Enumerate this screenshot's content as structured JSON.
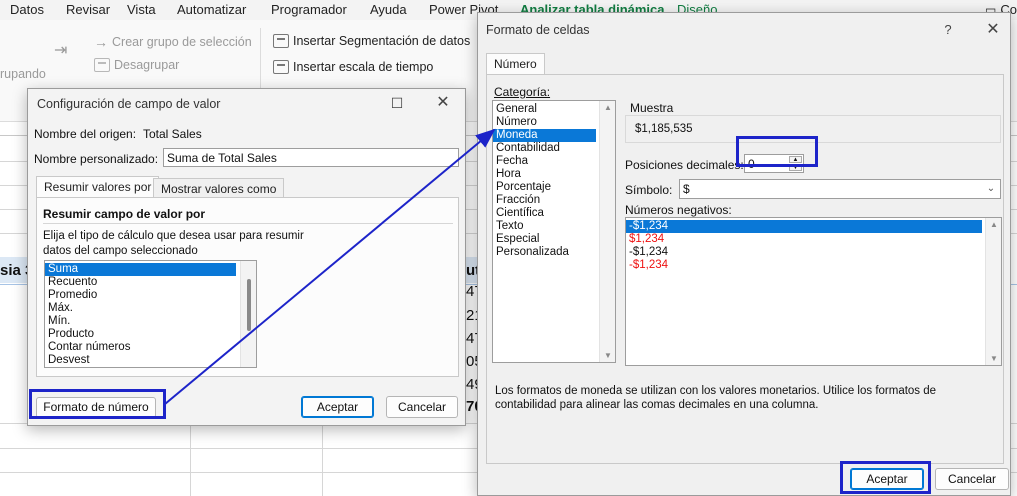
{
  "ribbon": {
    "tabs": [
      "Datos",
      "Revisar",
      "Vista",
      "Automatizar",
      "Programador",
      "Ayuda",
      "Power Pivot",
      "Analizar tabla dinámica",
      "Diseño"
    ],
    "commands": {
      "crear_grupo": "Crear grupo de selección",
      "desagrupar": "Desagrupar",
      "agrupando": "rupando",
      "insertar_segmentacion": "Insertar Segmentación de datos",
      "insertar_escala": "Insertar escala de tiempo",
      "co_partial": "Co"
    }
  },
  "sheet": {
    "cell_left": "sia 3",
    "col_partial": [
      "ut",
      "47",
      "21",
      "47",
      "05",
      "49",
      "70"
    ]
  },
  "value_field_dialog": {
    "title": "Configuración de campo de valor",
    "source_label": "Nombre del origen:",
    "source_value": "Total Sales",
    "custom_name_label": "Nombre personalizado:",
    "custom_name_value": "Suma de Total Sales",
    "tabs": [
      "Resumir valores por",
      "Mostrar valores como"
    ],
    "section_title": "Resumir campo de valor por",
    "description": "Elija el tipo de cálculo que desea usar para resumir datos del campo seleccionado",
    "description_line1": "Elija el tipo de cálculo que desea usar para resumir",
    "description_line2": "datos del campo seleccionado",
    "functions": [
      "Suma",
      "Recuento",
      "Promedio",
      "Máx.",
      "Mín.",
      "Producto",
      "Contar números",
      "Desvest"
    ],
    "selected_function": "Suma",
    "number_format_button": "Formato de número",
    "ok_button": "Aceptar",
    "cancel_button": "Cancelar"
  },
  "format_cells_dialog": {
    "title": "Formato de celdas",
    "help": "?",
    "tab": "Número",
    "category_label": "Categoría:",
    "categories": [
      "General",
      "Número",
      "Moneda",
      "Contabilidad",
      "Fecha",
      "Hora",
      "Porcentaje",
      "Fracción",
      "Científica",
      "Texto",
      "Especial",
      "Personalizada"
    ],
    "selected_category": "Moneda",
    "sample_label": "Muestra",
    "sample_value": "$1,185,535",
    "decimal_label": "Posiciones decimales:",
    "decimal_value": "0",
    "symbol_label": "Símbolo:",
    "symbol_value": "$",
    "negative_label": "Números negativos:",
    "negative_options": [
      {
        "text": "-$1,234",
        "color": "#ffffff",
        "selected": true
      },
      {
        "text": "$1,234",
        "color": "#e11111",
        "selected": false
      },
      {
        "text": "-$1,234",
        "color": "#111111",
        "selected": false
      },
      {
        "text": "-$1,234",
        "color": "#e11111",
        "selected": false
      }
    ],
    "description_line1": "Los formatos de moneda se utilizan con los valores monetarios. Utilice los formatos de",
    "description_line2": "contabilidad para alinear las comas decimales en una columna.",
    "ok_button": "Aceptar",
    "cancel_button": "Cancelar"
  },
  "annotation": {
    "highlight_color": "#1d24c9"
  }
}
